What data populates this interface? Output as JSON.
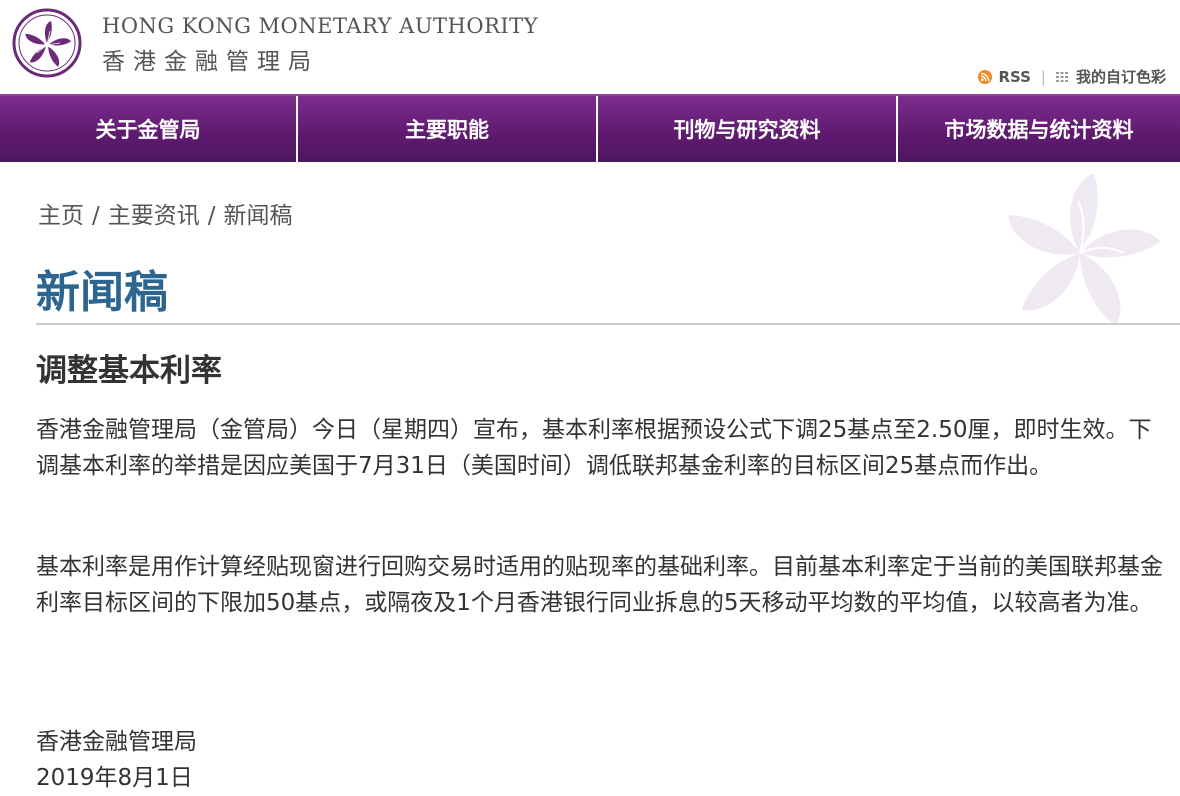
{
  "header": {
    "org_name_en": "HONG KONG MONETARY AUTHORITY",
    "org_name_zh": "香港金融管理局",
    "logo_icon": "bauhinia-logo-icon",
    "utility_links": {
      "rss_icon": "rss-icon",
      "rss_label": "RSS",
      "separator": "|",
      "custom_color_icon": "grid-dots-icon",
      "custom_color_label": "我的自订色彩"
    }
  },
  "nav": {
    "items": [
      {
        "label": "关于金管局"
      },
      {
        "label": "主要职能"
      },
      {
        "label": "刊物与研究资料"
      },
      {
        "label": "市场数据与统计资料"
      }
    ]
  },
  "breadcrumb": {
    "items": [
      "主页",
      "主要资讯",
      "新闻稿"
    ],
    "separator": "/"
  },
  "page": {
    "title": "新闻稿",
    "watermark_icon": "bauhinia-watermark-icon"
  },
  "article": {
    "title": "调整基本利率",
    "paragraphs": [
      "香港金融管理局（金管局）今日（星期四）宣布，基本利率根据预设公式下调25基点至2.50厘，即时生效。下调基本利率的举措是因应美国于7月31日（美国时间）调低联邦基金利率的目标区间25基点而作出。",
      "基本利率是用作计算经贴现窗进行回购交易时适用的贴现率的基础利率。目前基本利率定于当前的美国联邦基金利率目标区间的下限加50基点，或隔夜及1个月香港银行同业拆息的5天移动平均数的平均值，以较高者为准。"
    ],
    "signoff_org": "香港金融管理局",
    "signoff_date": "2019年8月1日"
  },
  "colors": {
    "nav_purple": "#5e1a6e",
    "title_blue": "#2c6590",
    "logo_purple": "#6b2a7a",
    "rss_orange": "#f08a24"
  }
}
